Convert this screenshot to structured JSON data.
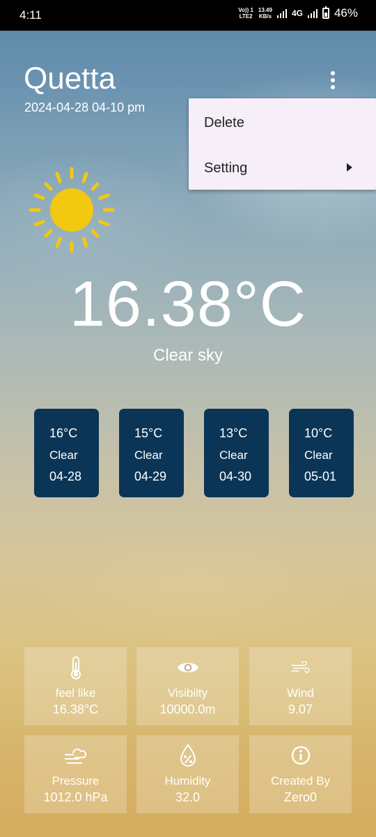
{
  "status_bar": {
    "time": "4:11",
    "volte_top": "Vo)) 1",
    "volte_bottom": "LTE2",
    "speed_top": "13.49",
    "speed_bottom": "KB/s",
    "network": "4G",
    "battery": "46%"
  },
  "header": {
    "city": "Quetta",
    "datetime": "2024-04-28 04-10 pm"
  },
  "menu": {
    "delete_label": "Delete",
    "setting_label": "Setting"
  },
  "current": {
    "temperature": "16.38°C",
    "condition": "Clear sky",
    "icon": "sun-icon",
    "sun_color": "#f2c811"
  },
  "forecast": [
    {
      "temp": "16°C",
      "condition": "Clear",
      "date": "04-28"
    },
    {
      "temp": "15°C",
      "condition": "Clear",
      "date": "04-29"
    },
    {
      "temp": "13°C",
      "condition": "Clear",
      "date": "04-30"
    },
    {
      "temp": "10°C",
      "condition": "Clear",
      "date": "05-01"
    }
  ],
  "details": [
    {
      "icon": "thermometer-icon",
      "label": "feel like",
      "value": "16.38°C"
    },
    {
      "icon": "eye-icon",
      "label": "Visibilty",
      "value": "10000.0m"
    },
    {
      "icon": "wind-icon",
      "label": "Wind",
      "value": "9.07"
    },
    {
      "icon": "pressure-icon",
      "label": "Pressure",
      "value": "1012.0 hPa"
    },
    {
      "icon": "humidity-icon",
      "label": "Humidity",
      "value": "32.0"
    },
    {
      "icon": "info-icon",
      "label": "Created By",
      "value": "Zero0"
    }
  ],
  "colors": {
    "forecast_card": "#0b3556",
    "menu_background": "#f6eef8"
  }
}
